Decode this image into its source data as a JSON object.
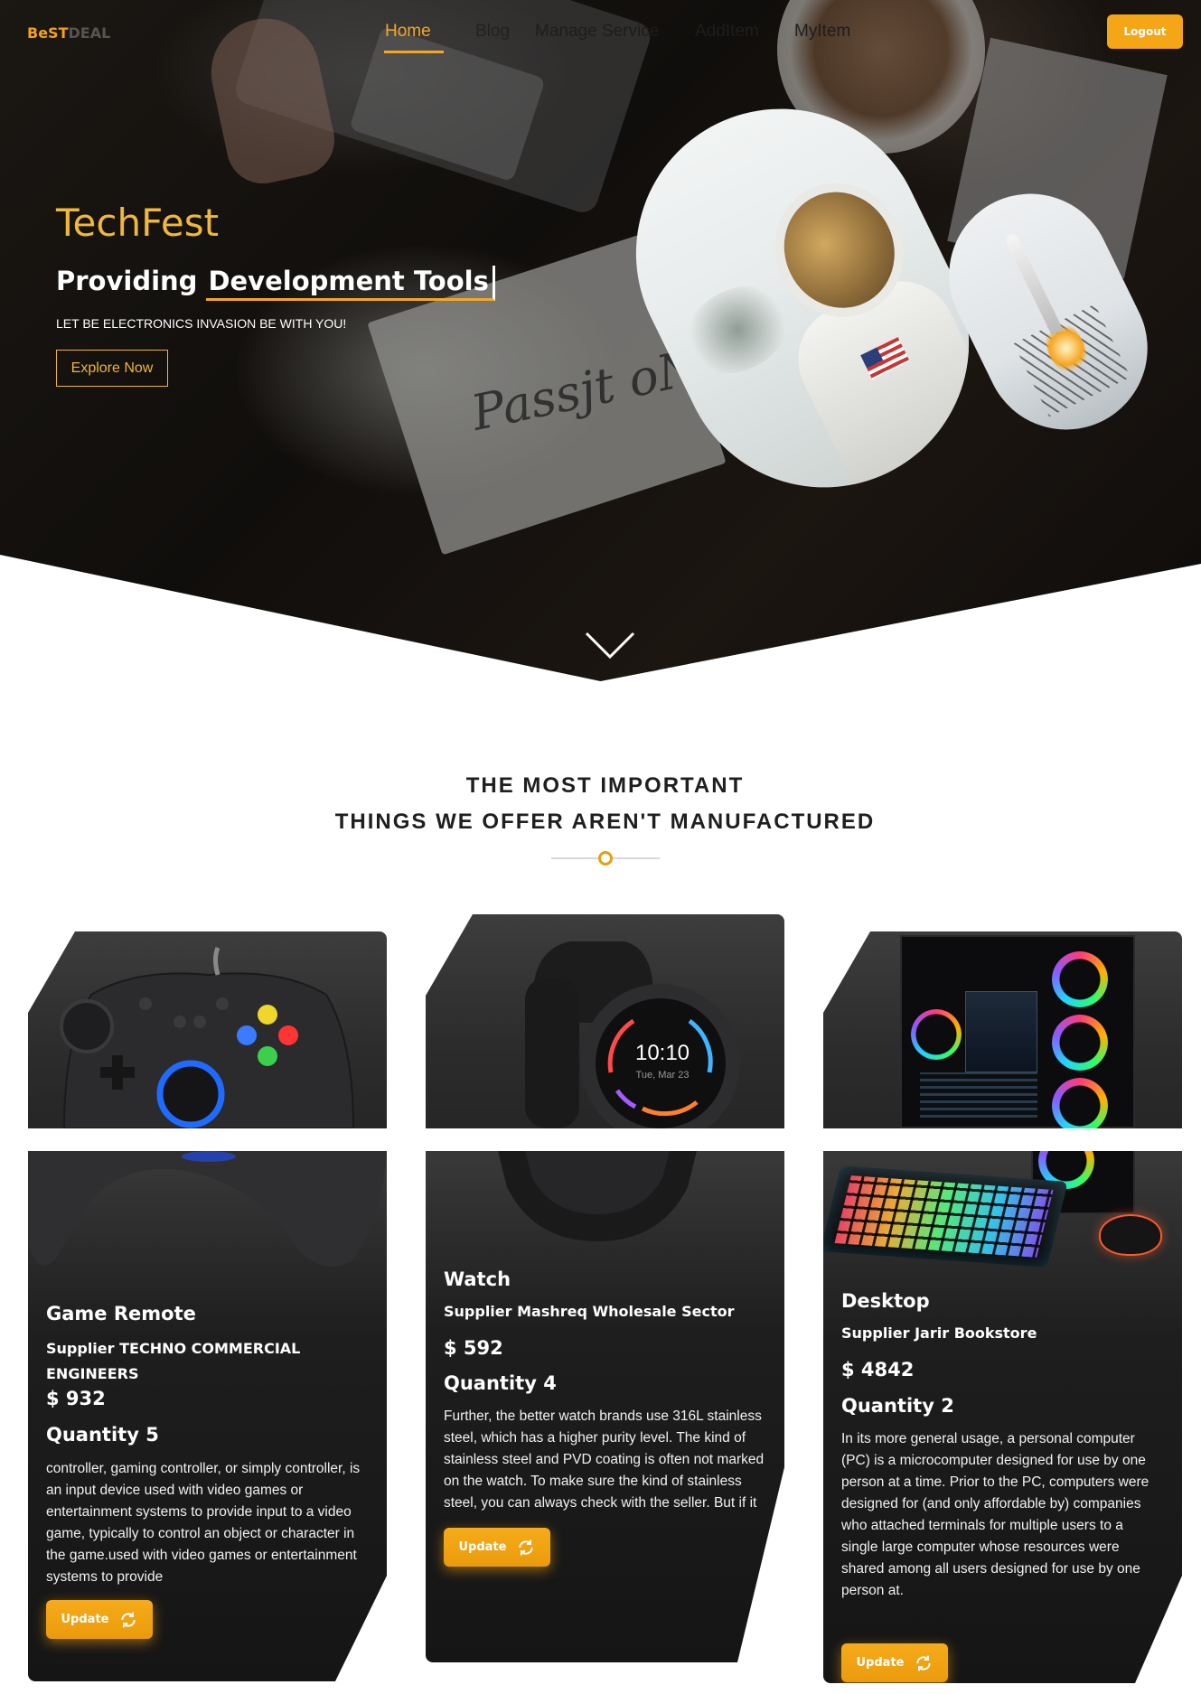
{
  "nav": {
    "brand": "BeST",
    "brand_faded": "DEAL",
    "links": [
      "Home",
      "Blog",
      "Manage Service",
      "AddItem",
      "MyItem"
    ],
    "logout_label": "Logout"
  },
  "hero": {
    "title": "TechFest",
    "subtitle_prefix": "Providing",
    "subtitle_typed": "Development Tools",
    "tagline": "LET BE ELECTRONICS INVASION BE WITH YOU!",
    "explore_label": "Explore Now",
    "notebook_text": "Passjt oN"
  },
  "section": {
    "title_line1": "THE MOST IMPORTANT",
    "title_line2": "THINGS WE OFFER AREN'T MANUFACTURED"
  },
  "products": [
    {
      "name": "Game Remote",
      "supplier": "Supplier TECHNO COMMERCIAL ENGINEERS",
      "price": "$ 932",
      "quantity": "Quantity 5",
      "description": "controller, gaming controller, or simply controller, is an input device used with video games or entertainment systems to provide input to a video game, typically to control an object or character in the game.used with video games or entertainment systems to provide",
      "update_label": "Update",
      "image_icon": "gamepad-icon"
    },
    {
      "name": "Watch",
      "supplier": "Supplier Mashreq Wholesale Sector",
      "price": "$ 592",
      "quantity": "Quantity 4",
      "description": "Further, the better watch brands use 316L stainless steel, which has a higher purity level. The kind of stainless steel and PVD coating is often not marked on the watch. To make sure the kind of stainless steel, you can always check with the seller. But if it is a more expensive brand you",
      "update_label": "Update",
      "image_icon": "smartwatch-icon",
      "watch_time": "10:10",
      "watch_date": "Tue, Mar 23"
    },
    {
      "name": "Desktop",
      "supplier": "Supplier Jarir Bookstore",
      "price": "$ 4842",
      "quantity": "Quantity 2",
      "description": "In its more general usage, a personal computer (PC) is a microcomputer designed for use by one person at a time. Prior to the PC, computers were designed for (and only affordable by) companies who attached terminals for multiple users to a single large computer whose resources were shared among all users designed for use by one person at.",
      "update_label": "Update",
      "image_icon": "desktop-pc-icon"
    }
  ],
  "colors": {
    "accent": "#f5a623",
    "hero_title": "#f0b83a",
    "card_bg": "#1e1e1e",
    "text_dark": "#1f1f1f"
  }
}
